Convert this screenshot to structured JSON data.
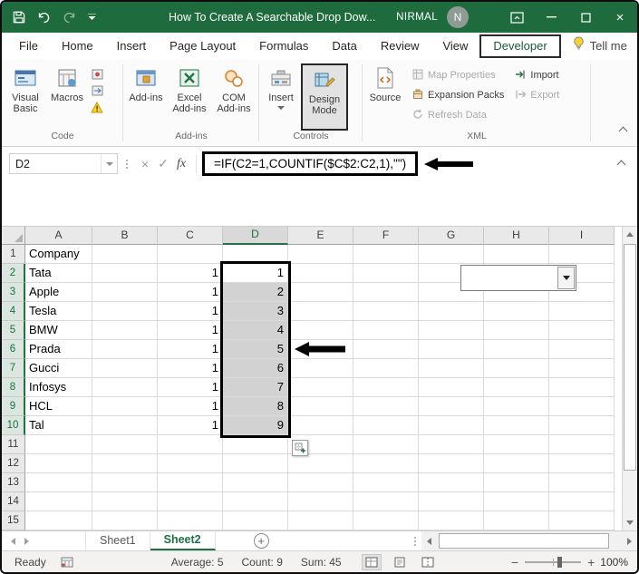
{
  "titlebar": {
    "title": "How To Create A Searchable Drop Dow...",
    "user": "NIRMAL",
    "avatar_initial": "N"
  },
  "ribbon_tabs": [
    {
      "label": "File"
    },
    {
      "label": "Home"
    },
    {
      "label": "Insert"
    },
    {
      "label": "Page Layout"
    },
    {
      "label": "Formulas"
    },
    {
      "label": "Data"
    },
    {
      "label": "Review"
    },
    {
      "label": "View"
    },
    {
      "label": "Developer",
      "active": true
    },
    {
      "label": "Tell me"
    }
  ],
  "ribbon": {
    "groups": [
      {
        "label": "Code",
        "buttons": [
          {
            "label": "Visual Basic"
          },
          {
            "label": "Macros"
          }
        ]
      },
      {
        "label": "Add-ins",
        "buttons": [
          {
            "label": "Add-ins"
          },
          {
            "label": "Excel Add-ins"
          },
          {
            "label": "COM Add-ins"
          }
        ]
      },
      {
        "label": "Controls",
        "buttons": [
          {
            "label": "Insert"
          },
          {
            "label": "Design Mode",
            "active": true
          }
        ]
      },
      {
        "label": "XML",
        "buttons": [
          {
            "label": "Source"
          },
          {
            "label": "Map Properties",
            "disabled": true
          },
          {
            "label": "Expansion Packs"
          },
          {
            "label": "Refresh Data",
            "disabled": true
          },
          {
            "label": "Import"
          },
          {
            "label": "Export",
            "disabled": true
          }
        ]
      }
    ]
  },
  "formula_bar": {
    "name_box": "D2",
    "fx_label": "fx",
    "formula": "=IF(C2=1,COUNTIF($C$2:C2,1),\"\")"
  },
  "sheet": {
    "columns": [
      "A",
      "B",
      "C",
      "D",
      "E",
      "F",
      "G",
      "H",
      "I"
    ],
    "selection": {
      "col": "D",
      "from": 2,
      "to": 10,
      "active": "D2"
    },
    "rows": [
      {
        "n": 1,
        "cells": {
          "A": "Company"
        }
      },
      {
        "n": 2,
        "cells": {
          "A": "Tata",
          "C": "1",
          "D": "1"
        }
      },
      {
        "n": 3,
        "cells": {
          "A": "Apple",
          "C": "1",
          "D": "2"
        }
      },
      {
        "n": 4,
        "cells": {
          "A": "Tesla",
          "C": "1",
          "D": "3"
        }
      },
      {
        "n": 5,
        "cells": {
          "A": "BMW",
          "C": "1",
          "D": "4"
        }
      },
      {
        "n": 6,
        "cells": {
          "A": "Prada",
          "C": "1",
          "D": "5"
        }
      },
      {
        "n": 7,
        "cells": {
          "A": "Gucci",
          "C": "1",
          "D": "6"
        }
      },
      {
        "n": 8,
        "cells": {
          "A": "Infosys",
          "C": "1",
          "D": "7"
        }
      },
      {
        "n": 9,
        "cells": {
          "A": "HCL",
          "C": "1",
          "D": "8"
        }
      },
      {
        "n": 10,
        "cells": {
          "A": "Tal",
          "C": "1",
          "D": "9"
        }
      },
      {
        "n": 11,
        "cells": {}
      },
      {
        "n": 12,
        "cells": {}
      },
      {
        "n": 13,
        "cells": {}
      },
      {
        "n": 14,
        "cells": {}
      },
      {
        "n": 15,
        "cells": {}
      }
    ]
  },
  "sheet_tabs": [
    {
      "label": "Sheet1"
    },
    {
      "label": "Sheet2",
      "active": true
    }
  ],
  "status_bar": {
    "ready": "Ready",
    "average": "Average: 5",
    "count": "Count: 9",
    "sum": "Sum: 45",
    "zoom": "100%"
  },
  "colors": {
    "excel_green": "#217346",
    "titlebar_green": "#1e6b3e",
    "annotation": "#000000"
  }
}
